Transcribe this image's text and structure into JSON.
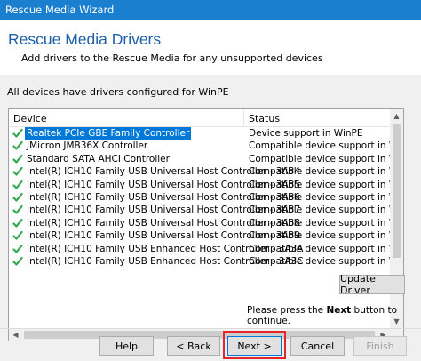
{
  "window": {
    "title": "Rescue Media Wizard"
  },
  "header": {
    "title": "Rescue Media Drivers",
    "subtitle": "Add drivers to the Rescue Media for any unsupported devices"
  },
  "status_line": "All devices have drivers configured for WinPE",
  "list": {
    "columns": [
      "Device",
      "Status"
    ],
    "rows": [
      {
        "device": "Realtek PCIe GBE Family Controller",
        "status": "Device support in WinPE",
        "selected": true
      },
      {
        "device": "JMicron JMB36X Controller",
        "status": "Compatible device support in WinPE"
      },
      {
        "device": "Standard SATA AHCI Controller",
        "status": "Compatible device support in WinPE"
      },
      {
        "device": "Intel(R) ICH10 Family USB Universal Host Controller - 3A34",
        "status": "Compatible device support in WinPE"
      },
      {
        "device": "Intel(R) ICH10 Family USB Universal Host Controller - 3A35",
        "status": "Compatible device support in WinPE"
      },
      {
        "device": "Intel(R) ICH10 Family USB Universal Host Controller - 3A36",
        "status": "Compatible device support in WinPE"
      },
      {
        "device": "Intel(R) ICH10 Family USB Universal Host Controller - 3A37",
        "status": "Compatible device support in WinPE"
      },
      {
        "device": "Intel(R) ICH10 Family USB Universal Host Controller - 3A38",
        "status": "Compatible device support in WinPE"
      },
      {
        "device": "Intel(R) ICH10 Family USB Universal Host Controller - 3A39",
        "status": "Compatible device support in WinPE"
      },
      {
        "device": "Intel(R) ICH10 Family USB Enhanced Host Controller - 3A3A",
        "status": "Compatible device support in WinPE"
      },
      {
        "device": "Intel(R) ICH10 Family USB Enhanced Host Controller - 3A3C",
        "status": "Compatible device support in WinPE"
      }
    ]
  },
  "buttons": {
    "update_driver": "Update Driver",
    "help": "Help",
    "back": "< Back",
    "next": "Next >",
    "cancel": "Cancel",
    "finish": "Finish"
  },
  "hint": {
    "prefix": "Please press the",
    "bold": "Next",
    "suffix": "button to continue."
  },
  "colors": {
    "titlebar": "#1a7fcf",
    "header_title": "#1f5fa8",
    "check": "#2fa84f",
    "selection": "#0078d7",
    "highlight_box": "#e3262a"
  },
  "icons": {
    "row_icon": "checkmark-icon"
  }
}
